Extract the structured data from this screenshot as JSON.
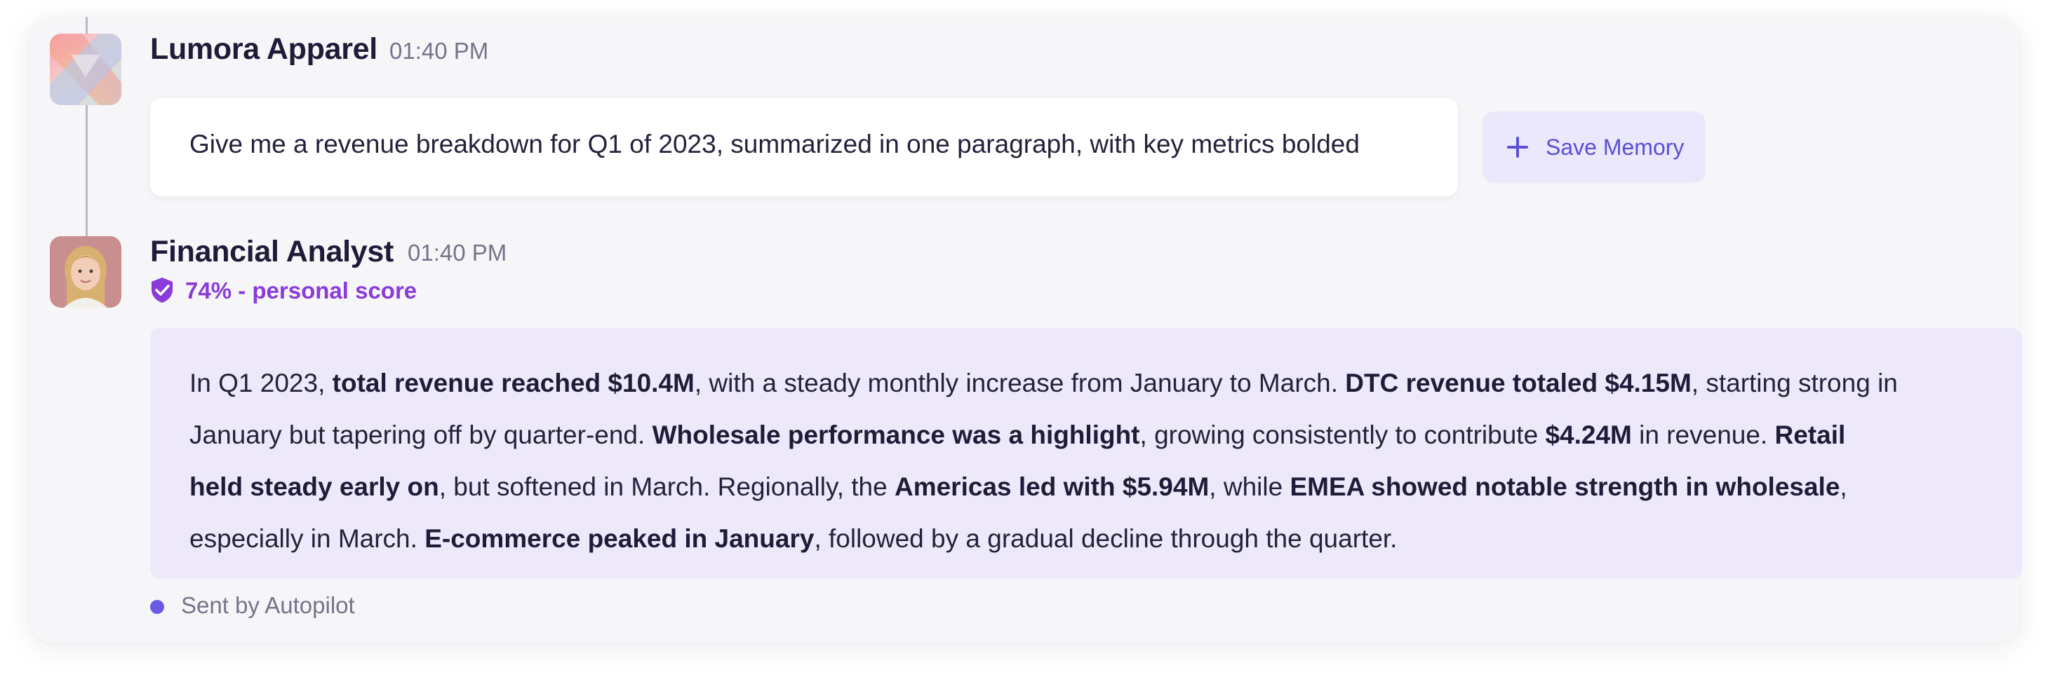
{
  "messages": {
    "user": {
      "name": "Lumora Apparel",
      "time": "01:40 PM",
      "text": "Give me a revenue breakdown for Q1 of 2023, summarized in one paragraph, with key metrics bolded"
    },
    "assistant": {
      "name": "Financial Analyst",
      "time": "01:40 PM",
      "score": "74% - personal score",
      "body": {
        "l1": [
          "In Q1 2023, ",
          "total revenue reached $10.4M",
          ", with a steady monthly increase from January to March. ",
          "DTC revenue totaled $4.15M",
          ", starting strong in"
        ],
        "l2": [
          "January but tapering off by quarter-end. ",
          "Wholesale performance was a highlight",
          ", growing consistently to contribute ",
          "$4.24M",
          " in revenue. ",
          "Retail"
        ],
        "l3": [
          "held steady early on",
          ", but softened in March. Regionally, the ",
          "Americas led with $5.94M",
          ", while ",
          "EMEA showed notable strength in wholesale",
          ","
        ],
        "l4": [
          "especially in March. ",
          "E-commerce peaked in January",
          ", followed by a gradual decline through the quarter."
        ]
      },
      "footer": "Sent by Autopilot"
    }
  },
  "actions": {
    "save_memory_label": "Save Memory",
    "save_memory_icon": "plus-icon"
  },
  "icons": {
    "score_icon": "shield-check-icon",
    "brand_avatar": "brand-logo-icon",
    "analyst_avatar": "person-avatar"
  },
  "colors": {
    "accent": "#5a4fd6",
    "score": "#8a3bd9",
    "assistant_bubble": "#ede9fb",
    "dot": "#6a5ae6"
  }
}
